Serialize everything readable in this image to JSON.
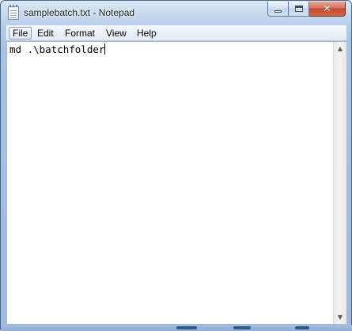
{
  "window": {
    "title": "samplebatch.txt - Notepad",
    "app_icon": "notepad-icon"
  },
  "controls": {
    "minimize_icon": "minimize-icon",
    "maximize_icon": "maximize-icon",
    "close_icon": "close-icon",
    "close_glyph": "✕"
  },
  "menu": {
    "items": [
      "File",
      "Edit",
      "Format",
      "View",
      "Help"
    ],
    "active": "File"
  },
  "editor": {
    "content": "md .\\batchfolder"
  },
  "scrollbar": {
    "up_arrow": "▲",
    "down_arrow": "▼"
  },
  "colors": {
    "close_button": "#c2472f",
    "frame": "#b6cde8",
    "editor_bg": "#ffffff"
  }
}
